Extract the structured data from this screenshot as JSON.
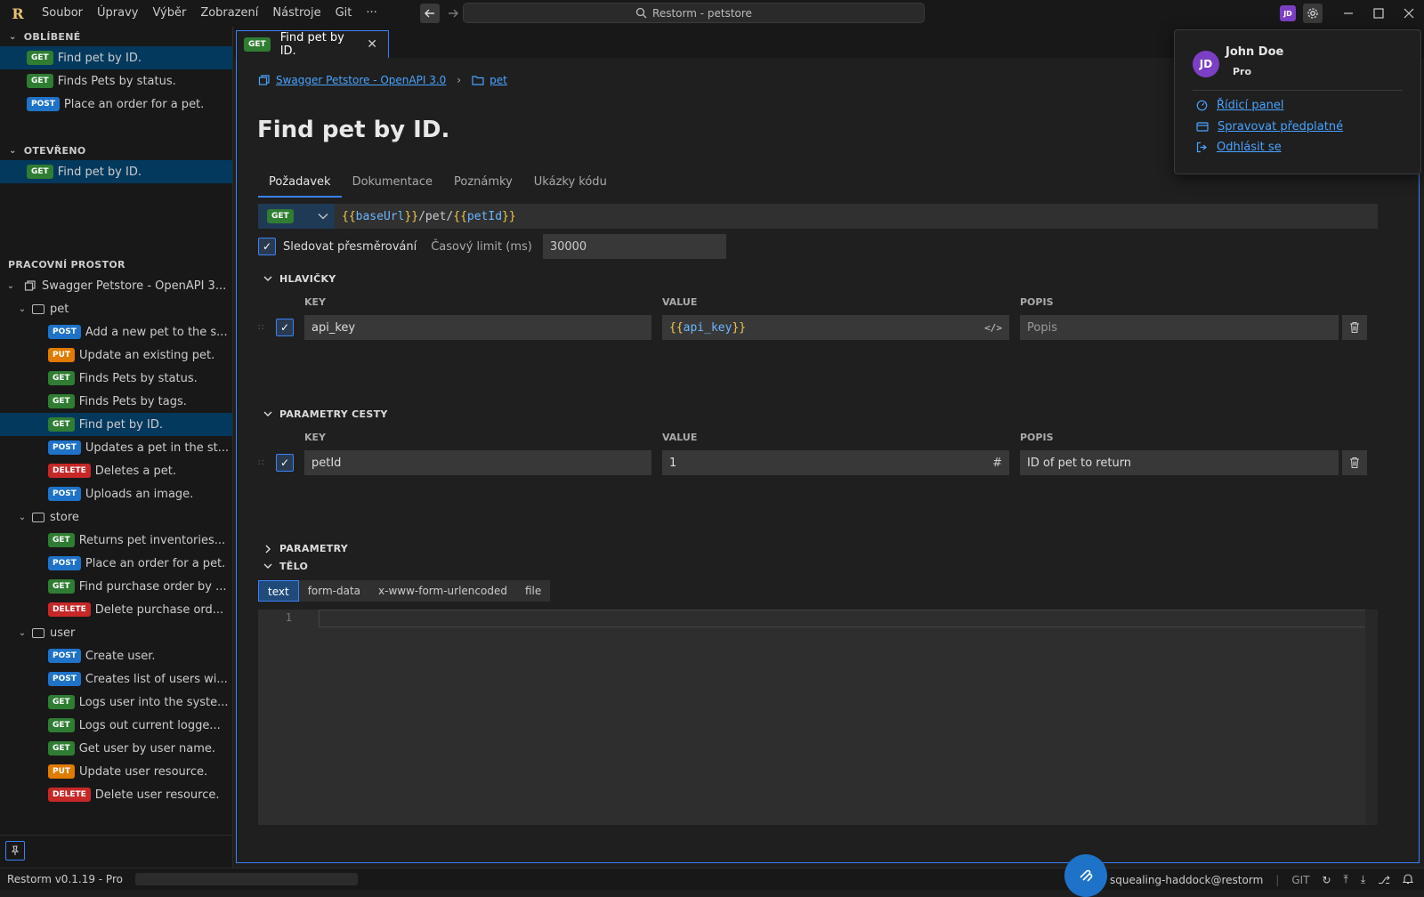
{
  "titlebar": {
    "menu": [
      "Soubor",
      "Úpravy",
      "Výběr",
      "Zobrazení",
      "Nástroje",
      "Git",
      "···"
    ],
    "search": "Restorm - petstore",
    "avatar_initials": "JD"
  },
  "sidebar": {
    "favorites_title": "OBLÍBENÉ",
    "favorites": [
      {
        "method": "GET",
        "label": "Find pet by ID."
      },
      {
        "method": "GET",
        "label": "Finds Pets by status."
      },
      {
        "method": "POST",
        "label": "Place an order for a pet."
      }
    ],
    "open_title": "OTEVŘENO",
    "open": [
      {
        "method": "GET",
        "label": "Find pet by ID."
      }
    ],
    "workspace_title": "PRACOVNÍ PROSTOR",
    "collection": "Swagger Petstore - OpenAPI 3...",
    "folders": [
      {
        "name": "pet",
        "items": [
          {
            "method": "POST",
            "label": "Add a new pet to the s..."
          },
          {
            "method": "PUT",
            "label": "Update an existing pet."
          },
          {
            "method": "GET",
            "label": "Finds Pets by status."
          },
          {
            "method": "GET",
            "label": "Finds Pets by tags."
          },
          {
            "method": "GET",
            "label": "Find pet by ID."
          },
          {
            "method": "POST",
            "label": "Updates a pet in the st..."
          },
          {
            "method": "DELETE",
            "label": "Deletes a pet."
          },
          {
            "method": "POST",
            "label": "Uploads an image."
          }
        ]
      },
      {
        "name": "store",
        "items": [
          {
            "method": "GET",
            "label": "Returns pet inventories..."
          },
          {
            "method": "POST",
            "label": "Place an order for a pet."
          },
          {
            "method": "GET",
            "label": "Find purchase order by ..."
          },
          {
            "method": "DELETE",
            "label": "Delete purchase ord..."
          }
        ]
      },
      {
        "name": "user",
        "items": [
          {
            "method": "POST",
            "label": "Create user."
          },
          {
            "method": "POST",
            "label": "Creates list of users wi..."
          },
          {
            "method": "GET",
            "label": "Logs user into the syste..."
          },
          {
            "method": "GET",
            "label": "Logs out current logge..."
          },
          {
            "method": "GET",
            "label": "Get user by user name."
          },
          {
            "method": "PUT",
            "label": "Update user resource."
          },
          {
            "method": "DELETE",
            "label": "Delete user resource."
          }
        ]
      }
    ]
  },
  "tab": {
    "method": "GET",
    "title": "Find pet by ID."
  },
  "breadcrumb": {
    "collection": "Swagger Petstore - OpenAPI 3.0",
    "folder": "pet"
  },
  "page_title": "Find pet by ID.",
  "request_tabs": [
    "Požadavek",
    "Dokumentace",
    "Poznámky",
    "Ukázky kódu"
  ],
  "request": {
    "method": "GET",
    "url_parts": [
      {
        "t": "{{",
        "c": "v"
      },
      {
        "t": "baseUrl",
        "c": "n"
      },
      {
        "t": "}}",
        "c": "v"
      },
      {
        "t": "/pet/",
        "c": ""
      },
      {
        "t": "{{",
        "c": "v"
      },
      {
        "t": "petId",
        "c": "n"
      },
      {
        "t": "}}",
        "c": "v"
      }
    ],
    "follow_redirects": "Sledovat přesměrování",
    "timeout_label": "Časový limit (ms)",
    "timeout_value": "30000"
  },
  "headers": {
    "title": "HLAVIČKY",
    "col_key": "KEY",
    "col_value": "VALUE",
    "col_desc": "POPIS",
    "rows": [
      {
        "key": "api_key",
        "value": "{{api_key}}",
        "desc_placeholder": "Popis"
      }
    ]
  },
  "path_params": {
    "title": "PARAMETRY CESTY",
    "col_key": "KEY",
    "col_value": "VALUE",
    "col_desc": "POPIS",
    "rows": [
      {
        "key": "petId",
        "value": "1",
        "desc": "ID of pet to return"
      }
    ]
  },
  "params_title": "PARAMETRY",
  "body": {
    "title": "TĚLO",
    "tabs": [
      "text",
      "form-data",
      "x-www-form-urlencoded",
      "file"
    ],
    "line": "1"
  },
  "profile": {
    "initials": "JD",
    "name": "John Doe",
    "plan": "Pro",
    "links": [
      "Řídicí panel",
      "Spravovat předplatné",
      "Odhlásit se"
    ]
  },
  "status": {
    "version": "Restorm v0.1.19 - Pro",
    "mcp": "mcp · squealing-haddock@restorm",
    "git": "GIT"
  }
}
